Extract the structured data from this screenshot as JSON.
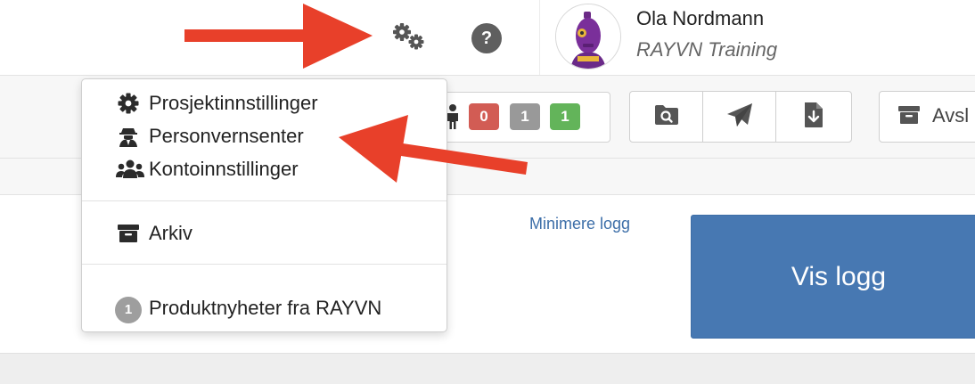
{
  "header": {
    "settings_icon": "gears-icon",
    "help_icon": "question-circle-icon",
    "help_glyph": "?",
    "user": {
      "name": "Ola Nordmann",
      "organization": "RAYVN Training",
      "avatar": "robot-avatar"
    }
  },
  "toolbar": {
    "person_icon": "person-icon",
    "status_badges": [
      {
        "value": "0",
        "color": "#d25c54"
      },
      {
        "value": "1",
        "color": "#999999"
      },
      {
        "value": "1",
        "color": "#63b45a"
      }
    ],
    "actions": [
      "search-folder-icon",
      "paper-plane-icon",
      "file-download-icon"
    ],
    "archive_button_label": "Avsl"
  },
  "dropdown": {
    "items": [
      {
        "label": "Prosjektinnstillinger",
        "icon": "gear-icon"
      },
      {
        "label": "Personvernsenter",
        "icon": "user-secret-icon"
      },
      {
        "label": "Kontoinnstillinger",
        "icon": "users-icon"
      }
    ],
    "archive": {
      "label": "Arkiv",
      "icon": "archive-icon"
    },
    "news": {
      "label": "Produktnyheter fra RAYVN",
      "count": "1"
    }
  },
  "log": {
    "minimize_link": "Minimere logg",
    "show_button": "Vis logg"
  },
  "colors": {
    "accent": "#4778b2",
    "link": "#3c6ea8",
    "annotation_arrow": "#e8402a"
  }
}
